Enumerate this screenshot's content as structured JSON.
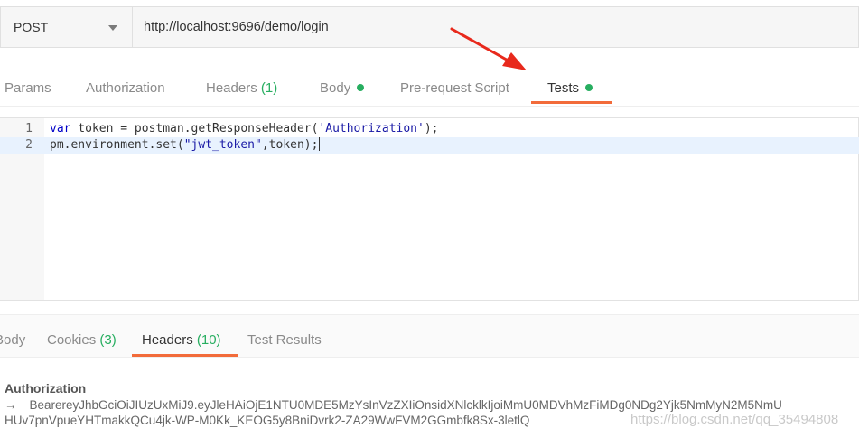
{
  "request": {
    "method": "POST",
    "url": "http://localhost:9696/demo/login"
  },
  "request_tabs": [
    {
      "label": "Params"
    },
    {
      "label": "Authorization"
    },
    {
      "label": "Headers",
      "count": "(1)"
    },
    {
      "label": "Body"
    },
    {
      "label": "Pre-request Script"
    },
    {
      "label": "Tests"
    }
  ],
  "editor": {
    "line_numbers": [
      "1",
      "2"
    ],
    "line1": {
      "kw": "var",
      "rest": " token = postman.getResponseHeader(",
      "str": "'Authorization'",
      "end": ");"
    },
    "line2": {
      "start": "pm.environment.set(",
      "str": "\"jwt_token\"",
      "end": ",token);"
    }
  },
  "response_tabs": [
    {
      "label": "Body"
    },
    {
      "label": "Cookies",
      "count": "(3)"
    },
    {
      "label": "Headers",
      "count": "(10)"
    },
    {
      "label": "Test Results"
    }
  ],
  "response_header": {
    "name": "Authorization",
    "arrow": "→",
    "value_line1": "BearereyJhbGciOiJIUzUxMiJ9.eyJleHAiOjE1NTU0MDE5MzYsInVzZXIiOnsidXNlcklkIjoiMmU0MDVhMzFiMDg0NDg2Yjk5NmMyN2M5NmU",
    "value_line2": "HUv7pnVpueYHTmakkQCu4jk-WP-M0Kk_KEOG5y8BniDvrk2-ZA29WwFVM2GGmbfk8Sx-3letlQ"
  },
  "watermark": "https://blog.csdn.net/qq_35494808",
  "colors": {
    "accent": "#f26b3a",
    "active_dot": "#27ae60",
    "annotation_arrow": "#e8291c"
  }
}
